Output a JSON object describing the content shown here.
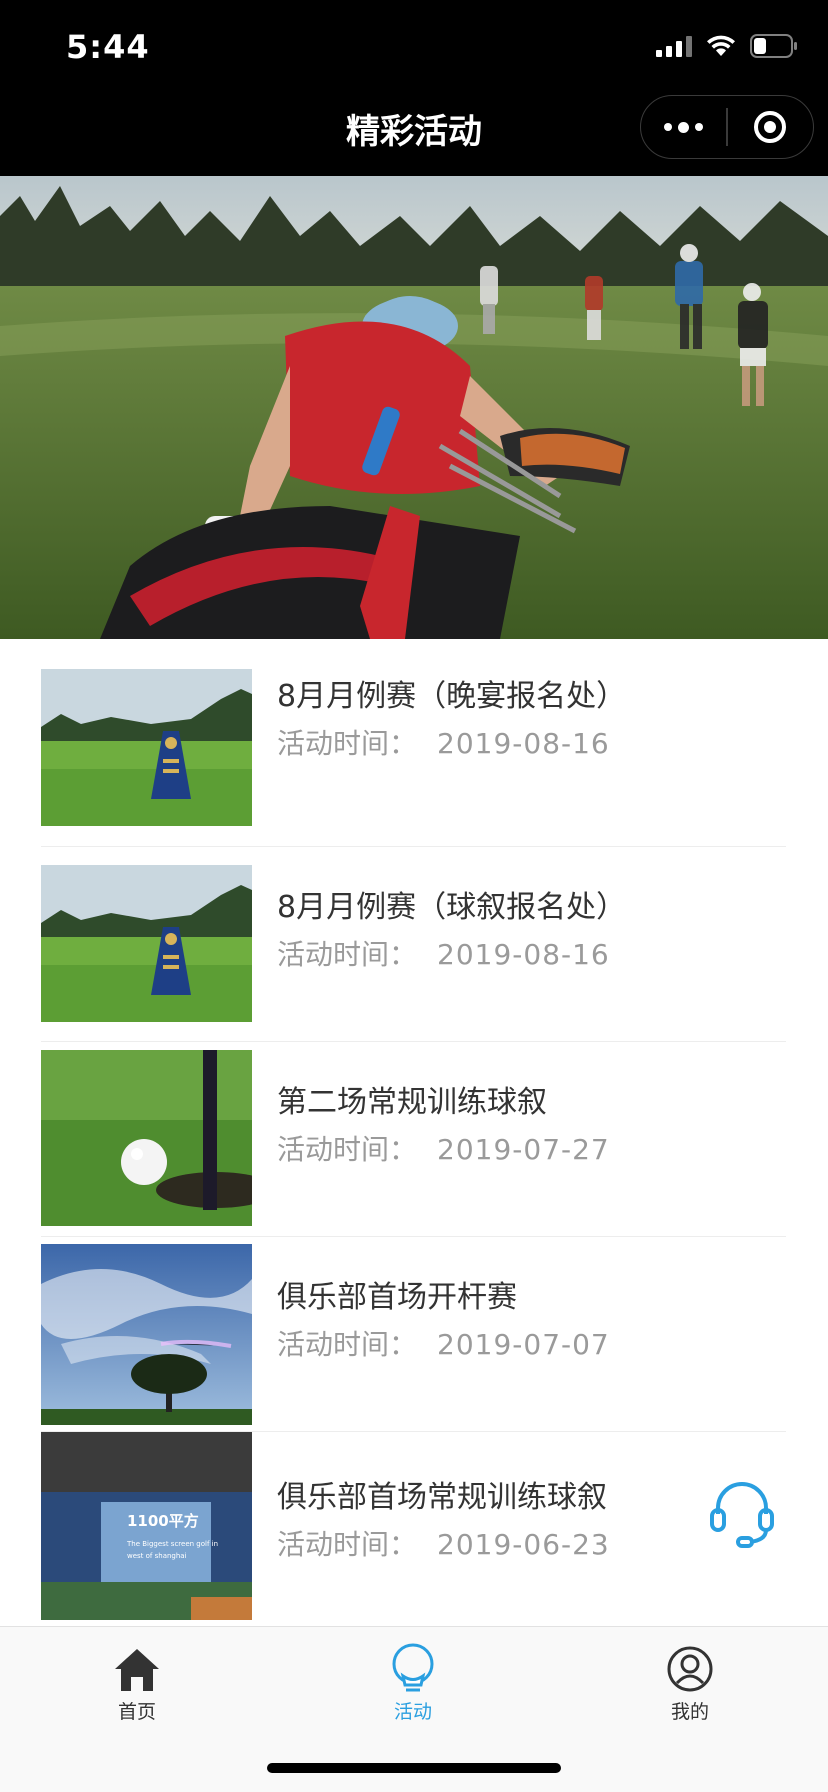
{
  "status_bar": {
    "time": "5:44"
  },
  "nav": {
    "title": "精彩活动"
  },
  "activities": [
    {
      "title": "8月月例赛（晚宴报名处）",
      "date_label": "活动时间：",
      "date": "2019-08-16"
    },
    {
      "title": "8月月例赛（球叙报名处）",
      "date_label": "活动时间：",
      "date": "2019-08-16"
    },
    {
      "title": "第二场常规训练球叙",
      "date_label": "活动时间：",
      "date": "2019-07-27"
    },
    {
      "title": "俱乐部首场开杆赛",
      "date_label": "活动时间：",
      "date": "2019-07-07"
    },
    {
      "title": "俱乐部首场常规训练球叙",
      "date_label": "活动时间：",
      "date": "2019-06-23"
    }
  ],
  "thumb5_text": {
    "big": "1100平方",
    "line1": "The Biggest screen golf in",
    "line2": "west of shanghai"
  },
  "tabbar": {
    "items": [
      {
        "label": "首页",
        "icon": "home-icon",
        "active": false
      },
      {
        "label": "活动",
        "icon": "bulb-icon",
        "active": true
      },
      {
        "label": "我的",
        "icon": "user-icon",
        "active": false
      }
    ]
  },
  "colors": {
    "accent": "#2a9fe0",
    "nav_bg": "#000000",
    "text": "#333333",
    "subtext": "#9a9a9a"
  }
}
